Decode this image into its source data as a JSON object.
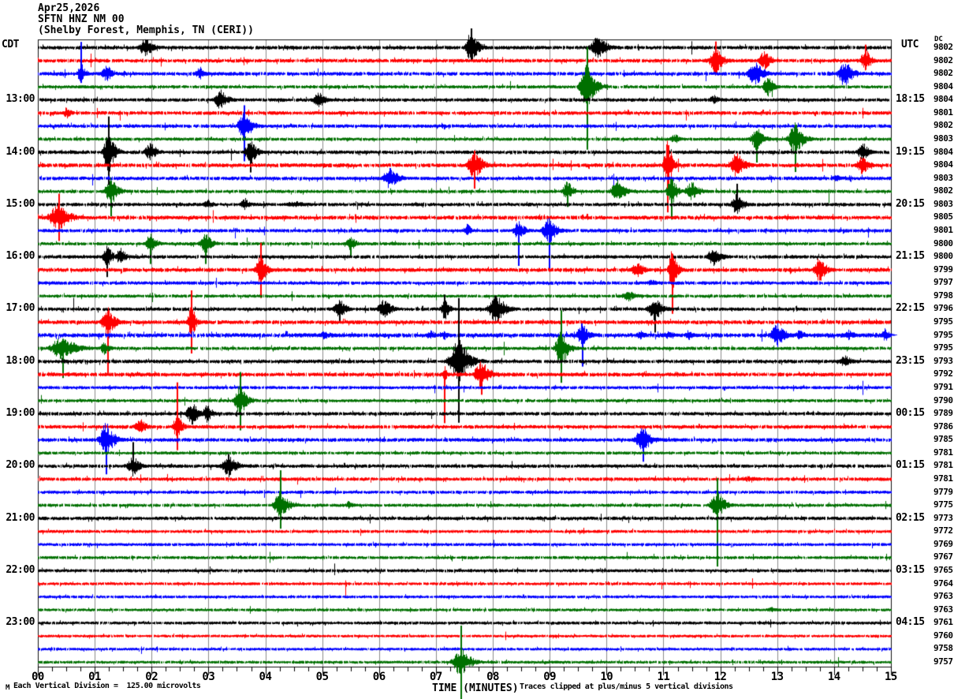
{
  "header": {
    "date": "Apr25,2026",
    "station": "SFTN HNZ NM 00",
    "location": "(Shelby Forest, Memphis, TN (CERI))"
  },
  "left_axis": {
    "timezone": "CDT",
    "labels": [
      "13:00",
      "14:00",
      "15:00",
      "16:00",
      "17:00",
      "18:00",
      "19:00",
      "20:00",
      "21:00",
      "22:00",
      "23:00"
    ]
  },
  "right_axis": {
    "timezone": "UTC",
    "labels": [
      "18:15",
      "19:15",
      "20:15",
      "21:15",
      "22:15",
      "23:15",
      "00:15",
      "01:15",
      "02:15",
      "03:15",
      "04:15"
    ]
  },
  "dc_column": {
    "header": "DC",
    "values": [
      9802,
      9802,
      9802,
      9804,
      9804,
      9801,
      9802,
      9803,
      9804,
      9804,
      9803,
      9802,
      9803,
      9805,
      9801,
      9800,
      9800,
      9799,
      9797,
      9798,
      9796,
      9795,
      9795,
      9795,
      9793,
      9792,
      9791,
      9790,
      9789,
      9786,
      9785,
      9781,
      9781,
      9781,
      9779,
      9775,
      9773,
      9772,
      9769,
      9767,
      9765,
      9764,
      9763,
      9763,
      9761,
      9760,
      9758,
      9757
    ]
  },
  "x_axis": {
    "labels": [
      "00",
      "01",
      "02",
      "03",
      "04",
      "05",
      "06",
      "07",
      "08",
      "09",
      "10",
      "11",
      "12",
      "13",
      "14",
      "15"
    ],
    "title": "TIME (MINUTES)"
  },
  "footer": {
    "left_note": "Each Vertical Division =  125.00 microvolts",
    "right_note": "Traces clipped at plus/minus 5 vertical divisions",
    "corner_mark": "M"
  },
  "chart_data": {
    "type": "line",
    "subtype": "helicorder",
    "x_minutes_range": [
      0,
      15
    ],
    "minutes_per_row": 15,
    "rows_count": 48,
    "minute_tick_step": 1,
    "minor_tick_step": 0.25,
    "division_microvolts": 125.0,
    "clip_divisions": 5,
    "grid_color": "#8c8c8c",
    "frame_color": "#111111",
    "trace_color_cycle": [
      "#000000",
      "#ff0000",
      "#0000ff",
      "#007000"
    ],
    "rows": [
      {
        "start_cdt": "12:00",
        "color": "#000000",
        "noise": 2.0,
        "events": [
          {
            "m": 1.9,
            "a": 13,
            "w": 0.35
          },
          {
            "m": 7.62,
            "a": 22,
            "w": 0.3,
            "su": 24,
            "sd": 18
          },
          {
            "m": 9.85,
            "a": 15,
            "w": 0.4
          }
        ]
      },
      {
        "start_cdt": "12:15",
        "color": "#ff0000",
        "noise": 2.0,
        "events": [
          {
            "m": 11.92,
            "a": 20,
            "w": 0.3,
            "su": 24,
            "sd": 14
          },
          {
            "m": 12.78,
            "a": 13,
            "w": 0.3
          },
          {
            "m": 14.55,
            "a": 16,
            "w": 0.25,
            "su": 20,
            "sd": 12
          }
        ]
      },
      {
        "start_cdt": "12:30",
        "color": "#0000ff",
        "noise": 2.0,
        "events": [
          {
            "m": 0.76,
            "a": 14,
            "w": 0.2,
            "su": 40,
            "sd": 12
          },
          {
            "m": 1.22,
            "a": 11,
            "w": 0.3
          },
          {
            "m": 2.85,
            "a": 9,
            "w": 0.25
          },
          {
            "m": 12.62,
            "a": 18,
            "w": 0.35
          },
          {
            "m": 14.2,
            "a": 18,
            "w": 0.35
          }
        ]
      },
      {
        "start_cdt": "12:45",
        "color": "#007000",
        "noise": 1.7,
        "events": [
          {
            "m": 9.66,
            "a": 30,
            "w": 0.35,
            "su": 50,
            "sd": 80
          },
          {
            "m": 12.85,
            "a": 13,
            "w": 0.3
          }
        ]
      },
      {
        "start_cdt": "13:00",
        "color": "#000000",
        "noise": 1.9,
        "events": [
          {
            "m": 3.22,
            "a": 13,
            "w": 0.35
          },
          {
            "m": 4.95,
            "a": 10,
            "w": 0.35
          },
          {
            "m": 11.9,
            "a": 6,
            "w": 0.3
          }
        ]
      },
      {
        "start_cdt": "13:15",
        "color": "#ff0000",
        "noise": 2.0,
        "events": [
          {
            "m": 0.51,
            "a": 8,
            "w": 0.2
          }
        ]
      },
      {
        "start_cdt": "13:30",
        "color": "#0000ff",
        "noise": 1.9,
        "events": [
          {
            "m": 3.63,
            "a": 24,
            "w": 0.3,
            "su": 26,
            "sd": 45
          }
        ]
      },
      {
        "start_cdt": "13:45",
        "color": "#007000",
        "noise": 1.7,
        "events": [
          {
            "m": 11.2,
            "a": 7,
            "w": 0.25
          },
          {
            "m": 12.65,
            "a": 17,
            "w": 0.3,
            "sd": 30
          },
          {
            "m": 13.32,
            "a": 22,
            "w": 0.35,
            "sd": 42
          }
        ]
      },
      {
        "start_cdt": "14:00",
        "color": "#000000",
        "noise": 2.0,
        "events": [
          {
            "m": 1.25,
            "a": 30,
            "w": 0.25,
            "su": 45,
            "sd": 42
          },
          {
            "m": 1.98,
            "a": 13,
            "w": 0.3
          },
          {
            "m": 3.74,
            "a": 17,
            "w": 0.3,
            "sd": 26
          },
          {
            "m": 14.52,
            "a": 12,
            "w": 0.3
          }
        ]
      },
      {
        "start_cdt": "14:15",
        "color": "#ff0000",
        "noise": 2.2,
        "events": [
          {
            "m": 7.68,
            "a": 20,
            "w": 0.35,
            "sd": 30
          },
          {
            "m": 11.07,
            "a": 35,
            "w": 0.2,
            "su": 25,
            "sd": 60
          },
          {
            "m": 12.3,
            "a": 17,
            "w": 0.35
          },
          {
            "m": 14.5,
            "a": 13,
            "w": 0.3
          }
        ]
      },
      {
        "start_cdt": "14:30",
        "color": "#0000ff",
        "noise": 2.0,
        "events": [
          {
            "m": 6.2,
            "a": 14,
            "w": 0.4
          },
          {
            "m": 14.05,
            "a": 5,
            "w": 0.25
          }
        ]
      },
      {
        "start_cdt": "14:45",
        "color": "#007000",
        "noise": 1.8,
        "events": [
          {
            "m": 1.29,
            "a": 20,
            "w": 0.3,
            "sd": 32
          },
          {
            "m": 9.32,
            "a": 14,
            "w": 0.25,
            "sd": 20
          },
          {
            "m": 10.2,
            "a": 16,
            "w": 0.35
          },
          {
            "m": 11.15,
            "a": 19,
            "w": 0.25,
            "sd": 36
          },
          {
            "m": 11.5,
            "a": 13,
            "w": 0.35
          }
        ]
      },
      {
        "start_cdt": "15:00",
        "color": "#000000",
        "noise": 1.9,
        "events": [
          {
            "m": 3.0,
            "a": 7,
            "w": 0.25
          },
          {
            "m": 3.65,
            "a": 8,
            "w": 0.25
          },
          {
            "m": 4.55,
            "a": 4,
            "w": 0.7
          },
          {
            "m": 12.3,
            "a": 15,
            "w": 0.3,
            "su": 26
          }
        ]
      },
      {
        "start_cdt": "15:15",
        "color": "#ff0000",
        "noise": 2.2,
        "events": [
          {
            "m": 0.38,
            "a": 18,
            "w": 0.5,
            "su": 30,
            "sd": 30
          }
        ]
      },
      {
        "start_cdt": "15:30",
        "color": "#0000ff",
        "noise": 1.9,
        "events": [
          {
            "m": 7.56,
            "a": 9,
            "w": 0.2
          },
          {
            "m": 8.45,
            "a": 12,
            "w": 0.3,
            "sd": 45
          },
          {
            "m": 9.0,
            "a": 17,
            "w": 0.35,
            "sd": 52
          }
        ]
      },
      {
        "start_cdt": "15:45",
        "color": "#007000",
        "noise": 1.7,
        "events": [
          {
            "m": 1.98,
            "a": 14,
            "w": 0.25,
            "sd": 26
          },
          {
            "m": 2.95,
            "a": 14,
            "w": 0.3,
            "sd": 26
          },
          {
            "m": 5.5,
            "a": 10,
            "w": 0.25,
            "sd": 16
          }
        ]
      },
      {
        "start_cdt": "16:00",
        "color": "#000000",
        "noise": 1.9,
        "events": [
          {
            "m": 1.22,
            "a": 16,
            "w": 0.25,
            "sd": 26
          },
          {
            "m": 1.45,
            "a": 12,
            "w": 0.25
          },
          {
            "m": 11.9,
            "a": 13,
            "w": 0.35
          }
        ]
      },
      {
        "start_cdt": "16:15",
        "color": "#ff0000",
        "noise": 2.2,
        "events": [
          {
            "m": 3.92,
            "a": 22,
            "w": 0.25,
            "su": 34,
            "sd": 36
          },
          {
            "m": 10.55,
            "a": 10,
            "w": 0.35
          },
          {
            "m": 11.16,
            "a": 30,
            "w": 0.2,
            "su": 20,
            "sd": 56
          },
          {
            "m": 13.75,
            "a": 17,
            "w": 0.3
          }
        ]
      },
      {
        "start_cdt": "16:30",
        "color": "#0000ff",
        "noise": 1.9,
        "events": [
          {
            "m": 10.8,
            "a": 4,
            "w": 0.4
          }
        ]
      },
      {
        "start_cdt": "16:45",
        "color": "#007000",
        "noise": 1.7,
        "events": [
          {
            "m": 10.38,
            "a": 8,
            "w": 0.35
          }
        ]
      },
      {
        "start_cdt": "17:00",
        "color": "#000000",
        "noise": 1.9,
        "events": [
          {
            "m": 5.31,
            "a": 13,
            "w": 0.3,
            "sd": 18
          },
          {
            "m": 6.1,
            "a": 13,
            "w": 0.35
          },
          {
            "m": 7.15,
            "a": 16,
            "w": 0.2,
            "su": 18
          },
          {
            "m": 8.07,
            "a": 20,
            "w": 0.4
          },
          {
            "m": 10.85,
            "a": 16,
            "w": 0.35,
            "sd": 30
          }
        ]
      },
      {
        "start_cdt": "17:15",
        "color": "#ff0000",
        "noise": 2.2,
        "events": [
          {
            "m": 1.23,
            "a": 22,
            "w": 0.3,
            "sd": 68
          },
          {
            "m": 2.7,
            "a": 23,
            "w": 0.2,
            "su": 40,
            "sd": 40
          }
        ]
      },
      {
        "start_cdt": "17:30",
        "color": "#0000ff",
        "noise": 2.4,
        "events": [
          {
            "m": 5.05,
            "a": 6,
            "w": 0.35
          },
          {
            "m": 6.9,
            "a": 7,
            "w": 0.25
          },
          {
            "m": 7.15,
            "a": 7,
            "w": 0.2
          },
          {
            "m": 9.58,
            "a": 16,
            "w": 0.3,
            "sd": 40
          },
          {
            "m": 10.6,
            "a": 6,
            "w": 0.3
          },
          {
            "m": 11.1,
            "a": 6,
            "w": 0.3
          },
          {
            "m": 11.45,
            "a": 7,
            "w": 0.25
          },
          {
            "m": 13.0,
            "a": 16,
            "w": 0.35
          },
          {
            "m": 13.4,
            "a": 7,
            "w": 0.25
          },
          {
            "m": 14.25,
            "a": 7,
            "w": 0.35
          },
          {
            "m": 14.9,
            "a": 9,
            "w": 0.2
          }
        ]
      },
      {
        "start_cdt": "17:45",
        "color": "#007000",
        "noise": 1.8,
        "events": [
          {
            "m": 0.45,
            "a": 16,
            "w": 0.6,
            "sd": 38
          },
          {
            "m": 1.18,
            "a": 9,
            "w": 0.25
          },
          {
            "m": 9.2,
            "a": 26,
            "w": 0.3,
            "su": 48,
            "sd": 44
          }
        ]
      },
      {
        "start_cdt": "18:00",
        "color": "#000000",
        "noise": 2.0,
        "events": [
          {
            "m": 7.4,
            "a": 30,
            "w": 0.45,
            "su": 80,
            "sd": 78
          },
          {
            "m": 14.2,
            "a": 8,
            "w": 0.35
          }
        ]
      },
      {
        "start_cdt": "18:15",
        "color": "#ff0000",
        "noise": 2.2,
        "events": [
          {
            "m": 7.15,
            "a": 12,
            "w": 0.1,
            "sd": 62
          },
          {
            "m": 7.8,
            "a": 20,
            "w": 0.35,
            "sd": 26
          }
        ]
      },
      {
        "start_cdt": "18:30",
        "color": "#0000ff",
        "noise": 1.7,
        "events": []
      },
      {
        "start_cdt": "18:45",
        "color": "#007000",
        "noise": 1.7,
        "events": [
          {
            "m": 3.56,
            "a": 21,
            "w": 0.3,
            "su": 36,
            "sd": 38
          }
        ]
      },
      {
        "start_cdt": "19:00",
        "color": "#000000",
        "noise": 1.9,
        "events": [
          {
            "m": 2.72,
            "a": 16,
            "w": 0.3
          },
          {
            "m": 2.98,
            "a": 12,
            "w": 0.25
          }
        ]
      },
      {
        "start_cdt": "19:15",
        "color": "#ff0000",
        "noise": 2.0,
        "events": [
          {
            "m": 1.8,
            "a": 11,
            "w": 0.3
          },
          {
            "m": 2.45,
            "a": 17,
            "w": 0.25,
            "su": 56,
            "sd": 30
          }
        ]
      },
      {
        "start_cdt": "19:30",
        "color": "#0000ff",
        "noise": 2.0,
        "events": [
          {
            "m": 1.2,
            "a": 23,
            "w": 0.35,
            "sd": 44
          },
          {
            "m": 10.65,
            "a": 17,
            "w": 0.4,
            "sd": 28
          }
        ]
      },
      {
        "start_cdt": "19:45",
        "color": "#007000",
        "noise": 1.6,
        "events": []
      },
      {
        "start_cdt": "20:00",
        "color": "#000000",
        "noise": 1.9,
        "events": [
          {
            "m": 1.68,
            "a": 14,
            "w": 0.3,
            "su": 30
          },
          {
            "m": 3.35,
            "a": 16,
            "w": 0.35
          }
        ]
      },
      {
        "start_cdt": "20:15",
        "color": "#ff0000",
        "noise": 1.9,
        "events": [
          {
            "m": 12.5,
            "a": 4,
            "w": 0.5
          }
        ]
      },
      {
        "start_cdt": "20:30",
        "color": "#0000ff",
        "noise": 1.7,
        "events": []
      },
      {
        "start_cdt": "20:45",
        "color": "#007000",
        "noise": 1.7,
        "events": [
          {
            "m": 4.27,
            "a": 19,
            "w": 0.35,
            "su": 44,
            "sd": 30
          },
          {
            "m": 5.47,
            "a": 6,
            "w": 0.2
          },
          {
            "m": 11.95,
            "a": 18,
            "w": 0.35,
            "su": 34,
            "sd": 78
          }
        ]
      },
      {
        "start_cdt": "21:00",
        "color": "#000000",
        "noise": 1.9,
        "events": []
      },
      {
        "start_cdt": "21:15",
        "color": "#ff0000",
        "noise": 1.6,
        "events": []
      },
      {
        "start_cdt": "21:30",
        "color": "#0000ff",
        "noise": 1.6,
        "events": []
      },
      {
        "start_cdt": "21:45",
        "color": "#007000",
        "noise": 1.6,
        "events": []
      },
      {
        "start_cdt": "22:00",
        "color": "#000000",
        "noise": 1.7,
        "events": []
      },
      {
        "start_cdt": "22:15",
        "color": "#ff0000",
        "noise": 1.5,
        "events": []
      },
      {
        "start_cdt": "22:30",
        "color": "#0000ff",
        "noise": 1.5,
        "events": []
      },
      {
        "start_cdt": "22:45",
        "color": "#007000",
        "noise": 1.5,
        "events": [
          {
            "m": 12.9,
            "a": 4,
            "w": 0.25
          }
        ]
      },
      {
        "start_cdt": "23:00",
        "color": "#000000",
        "noise": 1.6,
        "events": []
      },
      {
        "start_cdt": "23:15",
        "color": "#ff0000",
        "noise": 1.4,
        "events": []
      },
      {
        "start_cdt": "23:30",
        "color": "#0000ff",
        "noise": 1.4,
        "events": []
      },
      {
        "start_cdt": "23:45",
        "color": "#007000",
        "noise": 1.5,
        "events": [
          {
            "m": 7.45,
            "a": 20,
            "w": 0.4,
            "su": 46,
            "sd": 52
          }
        ]
      }
    ]
  }
}
